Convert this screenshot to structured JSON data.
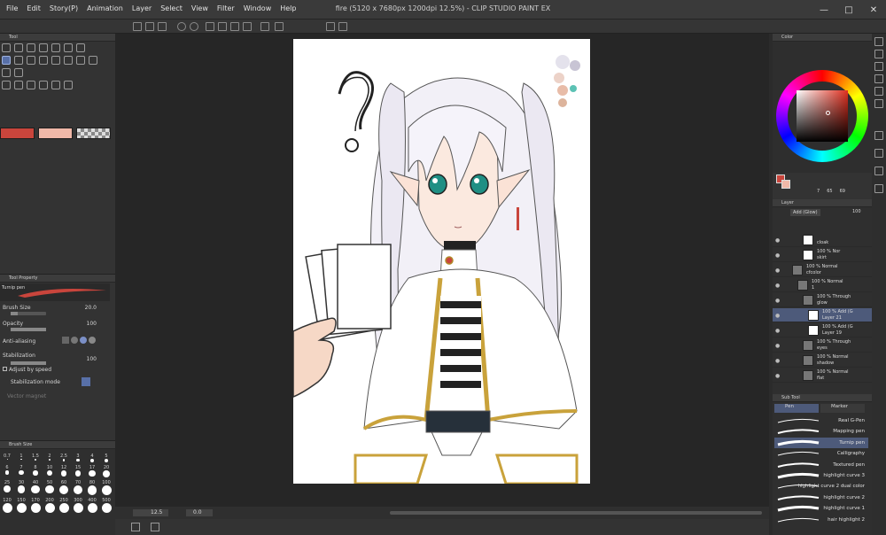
{
  "window": {
    "title": "fire (5120 x 7680px 1200dpi 12.5%) - CLIP STUDIO PAINT EX",
    "menus": [
      "File",
      "Edit",
      "Story(P)",
      "Animation",
      "Layer",
      "Select",
      "View",
      "Filter",
      "Window",
      "Help"
    ]
  },
  "tool_panel": {
    "tabs": [
      "Tool"
    ]
  },
  "tool_property": {
    "tab": "Tool Property",
    "brush_name": "Turnip pen",
    "brush_size_label": "Brush Size",
    "brush_size_value": "20.0",
    "opacity_label": "Opacity",
    "opacity_value": "100",
    "antialiasing_label": "Anti-aliasing",
    "stabilization_label": "Stabilization",
    "stabilization_value": "100",
    "adjust_speed_label": "Adjust by speed",
    "stabilization_mode_label": "Stabilization mode",
    "vector_magnet_label": "Vector magnet"
  },
  "brush_size_panel": {
    "tab": "Brush Size",
    "sizes": [
      "0.7",
      "1",
      "1.5",
      "2",
      "2.5",
      "3",
      "4",
      "5",
      "6",
      "7",
      "8",
      "10",
      "12",
      "15",
      "17",
      "20",
      "25",
      "30",
      "40",
      "50",
      "60",
      "70",
      "80",
      "100",
      "120",
      "150",
      "170",
      "200",
      "250",
      "300",
      "400",
      "500"
    ]
  },
  "colors": {
    "main": "#c9453c",
    "sub": "#f0b8a8",
    "accent_selection": "#4d5a7a",
    "palette": [
      "#e4e2ec",
      "#c8c4d4",
      "#ecd2c8",
      "#5cc2b4",
      "#e8bca8",
      "#ddb49c"
    ]
  },
  "navigator": {
    "zoom": "12.5",
    "angle": "0.0"
  },
  "color_panel": {
    "tab": "Color",
    "values": [
      "7",
      "65",
      "69"
    ]
  },
  "layer_panel": {
    "tab": "Layer",
    "blend": "Add (Glow)",
    "opacity": "100",
    "layers": [
      {
        "name": "cloak",
        "mode": "",
        "indent": 2,
        "selected": false,
        "folder": false
      },
      {
        "name": "skirt",
        "mode": "100 % Nor",
        "indent": 2,
        "selected": false,
        "folder": false
      },
      {
        "name": "cfcolor",
        "mode": "100 % Normal",
        "indent": 0,
        "selected": false,
        "folder": true
      },
      {
        "name": "1",
        "mode": "100 % Normal",
        "indent": 1,
        "selected": false,
        "folder": true
      },
      {
        "name": "glow",
        "mode": "100 % Through",
        "indent": 2,
        "selected": false,
        "folder": true
      },
      {
        "name": "Layer 21",
        "mode": "100 % Add (G",
        "indent": 3,
        "selected": true,
        "folder": false
      },
      {
        "name": "Layer 19",
        "mode": "100 % Add (G",
        "indent": 3,
        "selected": false,
        "folder": false
      },
      {
        "name": "eyes",
        "mode": "100 % Through",
        "indent": 2,
        "selected": false,
        "folder": true
      },
      {
        "name": "shadow",
        "mode": "100 % Normal",
        "indent": 2,
        "selected": false,
        "folder": true
      },
      {
        "name": "flat",
        "mode": "100 % Normal",
        "indent": 2,
        "selected": false,
        "folder": true
      }
    ]
  },
  "sub_tool_panel": {
    "tab": "Sub Tool",
    "groups": [
      "Pen",
      "Marker"
    ],
    "brushes": [
      {
        "name": "Real G-Pen",
        "selected": false
      },
      {
        "name": "Mapping pen",
        "selected": false
      },
      {
        "name": "Turnip pen",
        "selected": true
      },
      {
        "name": "Calligraphy",
        "selected": false
      },
      {
        "name": "Textured pen",
        "selected": false
      },
      {
        "name": "highlight curve 3",
        "selected": false
      },
      {
        "name": "highlight curve 2 dual color",
        "selected": false
      },
      {
        "name": "highlight curve 2",
        "selected": false
      },
      {
        "name": "highlight curve 1",
        "selected": false
      },
      {
        "name": "hair highlight 2",
        "selected": false
      }
    ]
  }
}
